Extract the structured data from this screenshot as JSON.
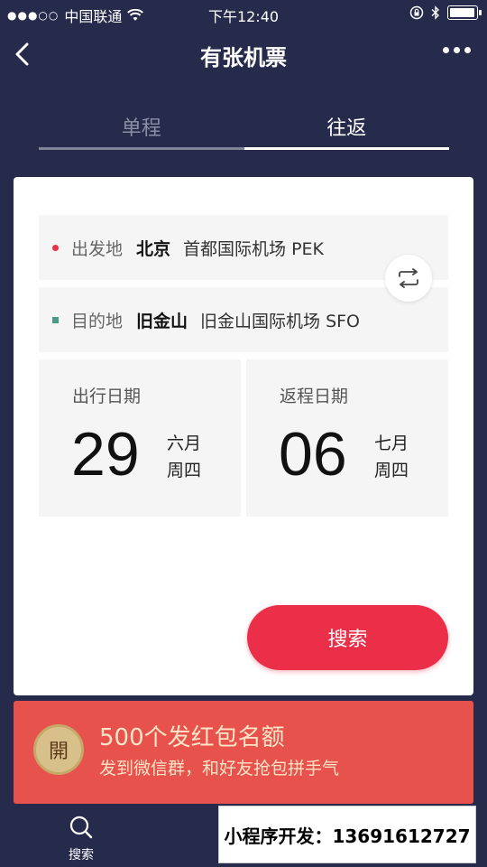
{
  "status_bar": {
    "signal": "●●●○○",
    "carrier": "中国联通",
    "time": "下午12:40"
  },
  "nav": {
    "title": "有张机票"
  },
  "tabs": [
    {
      "label": "单程",
      "active": false
    },
    {
      "label": "往返",
      "active": true
    }
  ],
  "departure": {
    "label": "出发地",
    "city": "北京",
    "airport": "首都国际机场 PEK"
  },
  "arrival": {
    "label": "目的地",
    "city": "旧金山",
    "airport": "旧金山国际机场 SFO"
  },
  "outbound_date": {
    "label": "出行日期",
    "day": "29",
    "month": "六月",
    "weekday": "周四"
  },
  "return_date": {
    "label": "返程日期",
    "day": "06",
    "month": "七月",
    "weekday": "周四"
  },
  "search_button": "搜索",
  "banner": {
    "coin_char": "開",
    "title": "500个发红包名额",
    "subtitle": "发到微信群，和好友抢包拼手气"
  },
  "tabbar": {
    "search_label": "搜索",
    "developer_text": "小程序开发：13691612727"
  },
  "colors": {
    "background": "#262b4b",
    "accent_red": "#ec2f48",
    "banner_red": "#e7524c",
    "departure_dot": "#e8344a",
    "arrival_dot": "#4a9a88"
  },
  "icons": {
    "back": "chevron-left-icon",
    "more": "more-dots-icon",
    "swap": "swap-icon",
    "search": "search-icon",
    "wifi": "wifi-icon",
    "lock": "rotation-lock-icon",
    "bluetooth": "bluetooth-icon",
    "battery": "battery-icon"
  }
}
